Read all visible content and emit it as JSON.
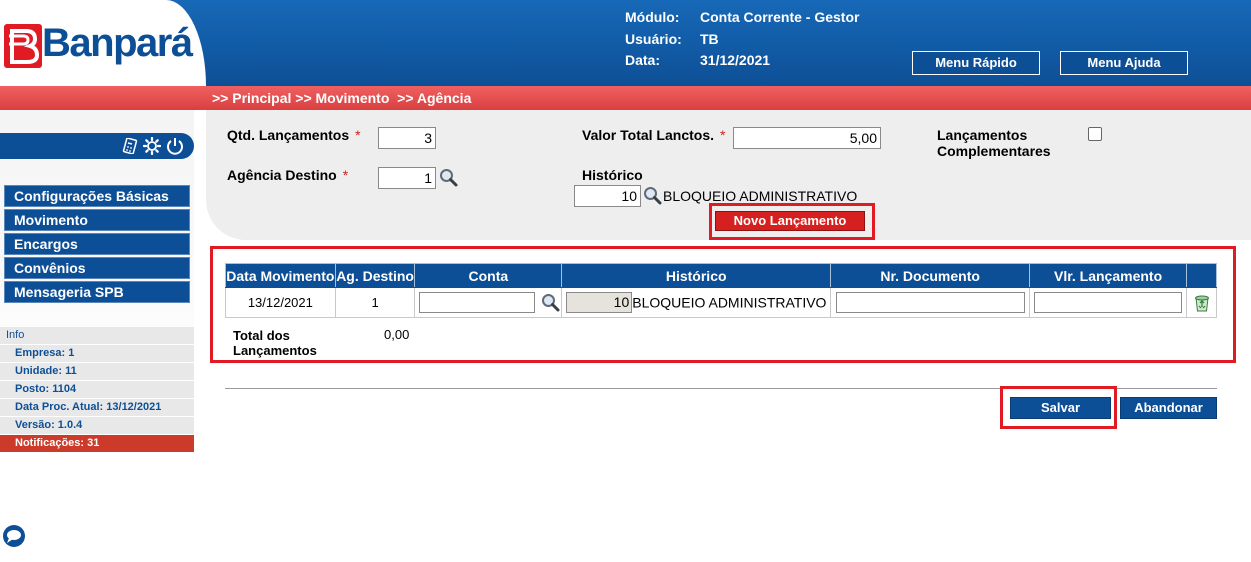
{
  "header": {
    "brand": "Banpará",
    "modulo_label": "Módulo:",
    "modulo_value": "Conta Corrente - Gestor",
    "usuario_label": "Usuário:",
    "usuario_value": "TB",
    "data_label": "Data:",
    "data_value": "31/12/2021",
    "menu_rapido": "Menu Rápido",
    "menu_ajuda": "Menu Ajuda"
  },
  "breadcrumb": ">> Principal >> Movimento  >> Agência",
  "sidebar": {
    "menu": [
      "Configurações Básicas",
      "Movimento",
      "Encargos",
      "Convênios",
      "Mensageria SPB"
    ],
    "info_title": "Info",
    "info": [
      "Empresa: 1",
      "Unidade: 11",
      "Posto: 1104",
      "Data Proc. Atual: 13/12/2021",
      "Versão: 1.0.4"
    ],
    "notificacoes": "Notificações: 31"
  },
  "form": {
    "qtd_label": "Qtd. Lançamentos",
    "qtd_value": "3",
    "valor_label": "Valor Total Lanctos.",
    "valor_value": "5,00",
    "compl_label_1": "Lançamentos",
    "compl_label_2": "Complementares",
    "agencia_label": "Agência Destino",
    "agencia_value": "1",
    "historico_label": "Histórico",
    "historico_code": "10",
    "historico_desc": "BLOQUEIO ADMINISTRATIVO",
    "required_mark": "*",
    "novo_lancamento": "Novo Lançamento"
  },
  "table": {
    "headers": [
      "Data Movimento",
      "Ag. Destino",
      "Conta",
      "Histórico",
      "Nr. Documento",
      "Vlr. Lançamento"
    ],
    "rows": [
      {
        "data": "13/12/2021",
        "agencia": "1",
        "conta": "",
        "hist_code": "10",
        "hist_desc": "BLOQUEIO ADMINISTRATIVO",
        "nr_doc": "",
        "valor": ""
      }
    ],
    "total_label_1": "Total dos",
    "total_label_2": "Lançamentos",
    "total_value": "0,00"
  },
  "actions": {
    "salvar": "Salvar",
    "abandonar": "Abandonar"
  },
  "colors": {
    "brand_blue": "#0d4f96",
    "brand_red": "#d62020",
    "highlight_red": "#e01b24"
  }
}
